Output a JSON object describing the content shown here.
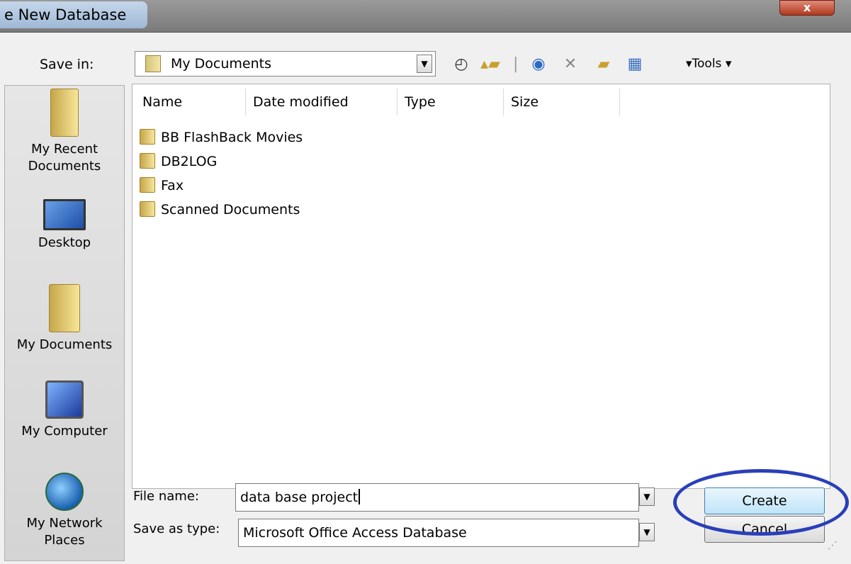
{
  "window": {
    "title": "e New Database",
    "close_label": "x"
  },
  "save_in": {
    "label": "Save in:",
    "value": "My Documents"
  },
  "toolbar": {
    "tools_label": "▾Tools ▾"
  },
  "places": [
    {
      "label": "My Recent Documents",
      "icon": "recent-documents-icon"
    },
    {
      "label": "Desktop",
      "icon": "desktop-icon"
    },
    {
      "label": "My Documents",
      "icon": "my-documents-icon"
    },
    {
      "label": "My Computer",
      "icon": "my-computer-icon"
    },
    {
      "label": "My Network Places",
      "icon": "network-places-icon"
    }
  ],
  "columns": [
    "Name",
    "Date modified",
    "Type",
    "Size"
  ],
  "files": [
    "BB FlashBack Movies",
    "DB2LOG",
    "Fax",
    "Scanned Documents"
  ],
  "file_name": {
    "label": "File name:",
    "value": "data base project"
  },
  "save_as_type": {
    "label": "Save as type:",
    "value": "Microsoft Office Access Database"
  },
  "buttons": {
    "create": "Create",
    "cancel": "Cancel"
  }
}
